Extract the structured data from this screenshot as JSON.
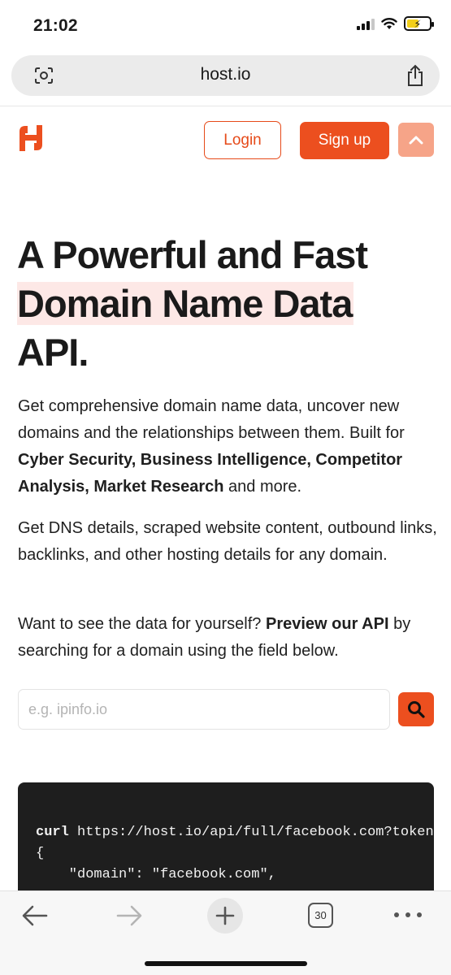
{
  "status_bar": {
    "time": "21:02",
    "icons": [
      "signal-icon",
      "wifi-icon",
      "battery-charging-icon"
    ],
    "battery_level": 0.45
  },
  "browser": {
    "url": "host.io",
    "icons": [
      "lens-icon",
      "share-icon"
    ]
  },
  "header": {
    "logo": "host-io-logo",
    "login_label": "Login",
    "signup_label": "Sign up",
    "collapse_icon": "chevron-up-icon"
  },
  "hero": {
    "title_line1": "A Powerful and Fast",
    "title_highlight": "Domain Name Data",
    "title_line3": "API.",
    "intro_text": "Get comprehensive domain name data, uncover new domains and the relationships between them. Built for ",
    "intro_bold1": "Cyber Security, Business Intelligence, Competitor Analysis, Market Research",
    "intro_tail": " and more.",
    "details_text": "Get DNS details, scraped website content, outbound links, backlinks, and other hosting details for any domain.",
    "preview_pre": "Want to see the data for yourself? ",
    "preview_bold": "Preview our API",
    "preview_post": " by searching for a domain using the field below."
  },
  "search": {
    "placeholder": "e.g. ipinfo.io",
    "value": "",
    "button_icon": "search-icon"
  },
  "code": {
    "cmd": "curl",
    "url": " https://host.io/api/full/facebook.com?token=",
    "line2": "{",
    "line3": "    \"domain\": \"facebook.com\","
  },
  "toolbar": {
    "tab_count": "30",
    "icons": [
      "back-arrow-icon",
      "forward-arrow-icon",
      "plus-icon",
      "tabs-icon",
      "more-icon"
    ]
  },
  "colors": {
    "brand": "#ec4f1f",
    "brand_light": "#f6a488",
    "highlight": "#fde8e6",
    "code_bg": "#1e1e1e"
  }
}
